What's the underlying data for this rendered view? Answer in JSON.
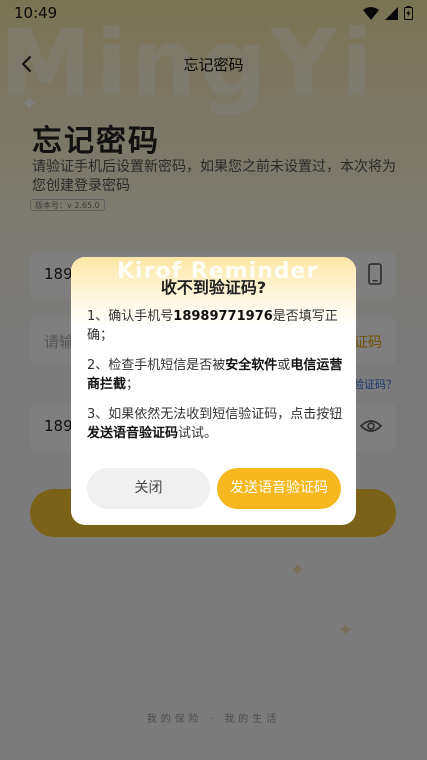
{
  "status_bar": {
    "time": "10:49"
  },
  "nav": {
    "title": "忘记密码"
  },
  "background_watermark": "MingYi",
  "heading": "忘记密码",
  "subtext": "请验证手机后设置新密码，如果您之前未设置过，本次将为您创建登录密码",
  "version": "版本号：v 2.65.0",
  "form": {
    "phone_value": "1898",
    "code_placeholder": "请输",
    "get_code_label": "验证码",
    "no_code_link": "验证码？",
    "password_value": "189"
  },
  "footer": "我的保险 · 我的生活",
  "dialog": {
    "watermark": "Kirof Reminder",
    "title": "收不到验证码?",
    "item1_prefix": "1、确认手机号",
    "item1_phone": "18989771976",
    "item1_suffix": "是否填写正确；",
    "item2_prefix": "2、检查手机短信是否被",
    "item2_bold1": "安全软件",
    "item2_mid": "或",
    "item2_bold2": "电信运营商拦截",
    "item2_suffix": "；",
    "item3_prefix": "3、如果依然无法收到短信验证码，点击按钮",
    "item3_bold": "发送语音验证码",
    "item3_suffix": "试试。",
    "close_label": "关闭",
    "voice_label": "发送语音验证码"
  },
  "colors": {
    "accent": "#f6b81e",
    "link": "#3b6fd8"
  }
}
